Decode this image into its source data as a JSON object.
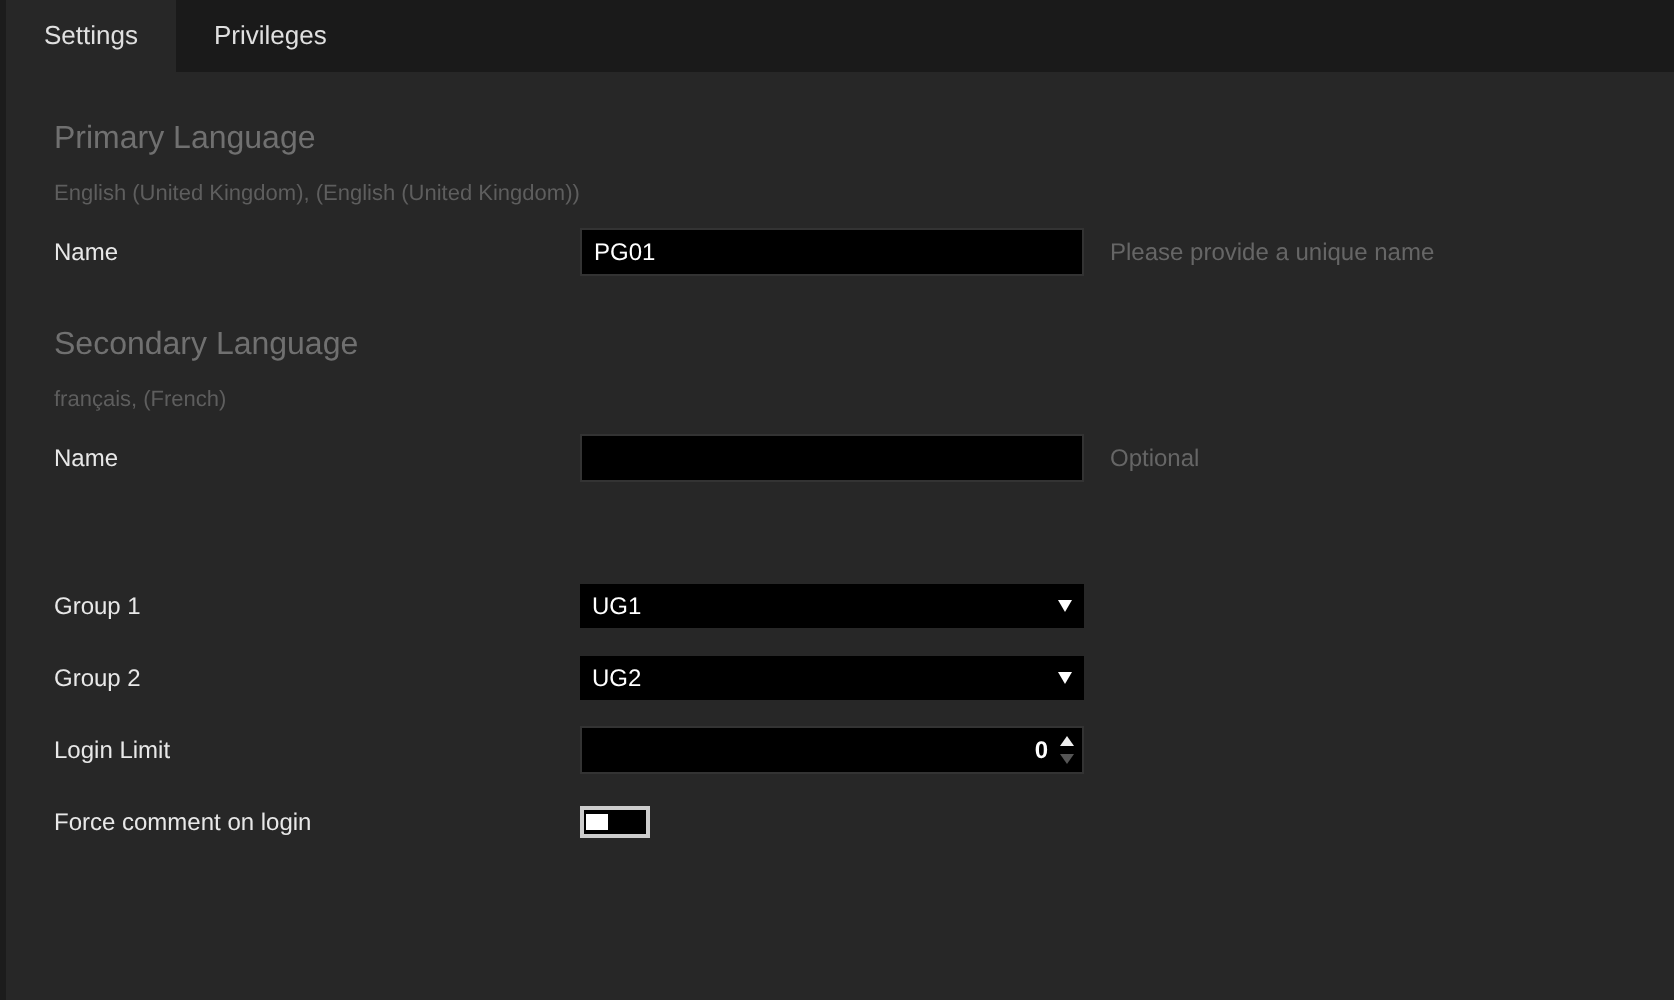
{
  "tabs": [
    {
      "label": "Settings",
      "selected": true
    },
    {
      "label": "Privileges",
      "selected": false
    }
  ],
  "languages": [
    {
      "heading": "Primary Language",
      "subtitle": "English (United Kingdom), (English (United Kingdom))",
      "field": {
        "label": "Name",
        "value": "PG01",
        "hint": "Please provide a unique name"
      }
    },
    {
      "heading": "Secondary Language",
      "subtitle": "français, (French)",
      "field": {
        "label": "Name",
        "hint": "Optional"
      }
    }
  ],
  "fields": [
    {
      "kind": "select",
      "label": "Group 1",
      "value": "UG1"
    },
    {
      "kind": "select",
      "label": "Group 2",
      "value": "UG2"
    },
    {
      "kind": "number",
      "label": "Login Limit",
      "value": "0"
    },
    {
      "kind": "toggle",
      "label": "Force comment on login",
      "on": false
    }
  ]
}
